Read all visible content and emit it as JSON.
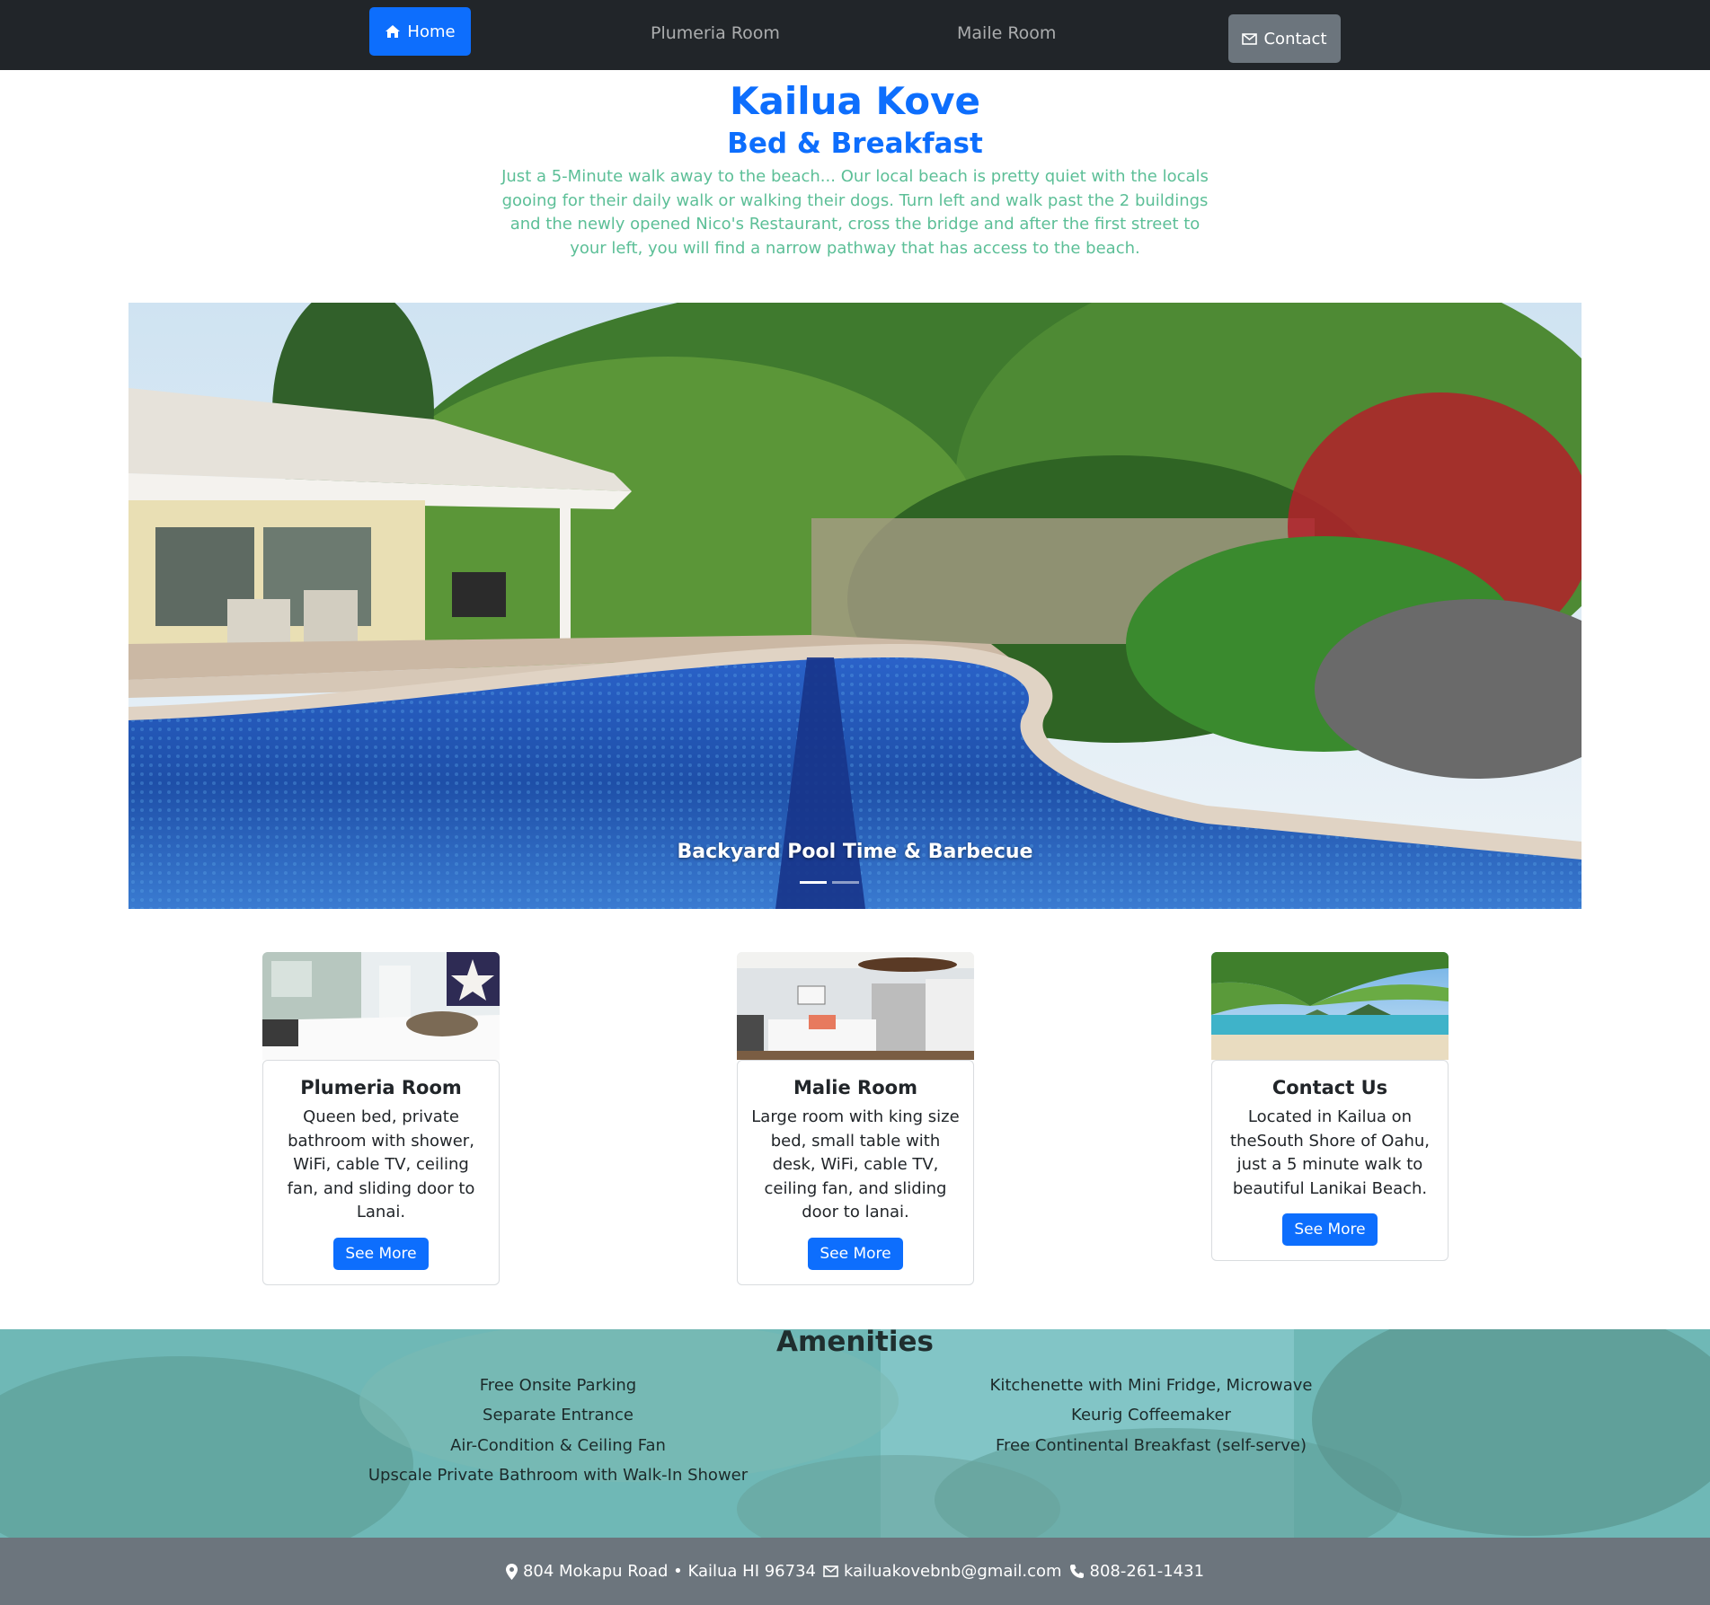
{
  "nav": {
    "home_label": "Home",
    "plumeria_label": "Plumeria Room",
    "maile_label": "Maile Room",
    "contact_label": "Contact"
  },
  "header": {
    "title": "Kailua Kove",
    "subtitle": "Bed & Breakfast",
    "intro": "Just a 5-Minute walk away to the beach... Our local beach is pretty quiet with the locals gooing for their daily walk or walking their dogs. Turn left and walk past the 2 buildings and the newly opened Nico's Restaurant, cross the bridge and after the first street to your left, you will find a narrow pathway that has access to the beach."
  },
  "carousel": {
    "caption": "Backyard Pool Time & Barbecue"
  },
  "cards": [
    {
      "title": "Plumeria Room",
      "text": "Queen bed, private bathroom with shower, WiFi, cable TV, ceiling fan, and sliding door to Lanai.",
      "button": "See More"
    },
    {
      "title": "Malie Room",
      "text": "Large room with king size bed, small table with desk, WiFi, cable TV, ceiling fan, and sliding door to lanai.",
      "button": "See More"
    },
    {
      "title": "Contact Us",
      "text": "Located in Kailua on theSouth Shore of Oahu, just a 5 minute walk to beautiful Lanikai Beach.",
      "button": "See More"
    }
  ],
  "amenities": {
    "title": "Amenities",
    "left": [
      "Free Onsite Parking",
      "Separate Entrance",
      "Air-Condition & Ceiling Fan",
      "Upscale Private Bathroom with Walk-In Shower"
    ],
    "right": [
      "Kitchenette with Mini Fridge, Microwave",
      "Keurig Coffeemaker",
      "Free Continental Breakfast (self-serve)"
    ]
  },
  "footer": {
    "address": "804 Mokapu Road • Kailua HI 96734",
    "email": "kailuakovebnb@gmail.com",
    "phone": "808-261-1431"
  },
  "colors": {
    "primary": "#0d6efd",
    "navbar": "#212529",
    "secondary": "#6c757d",
    "intro_text": "#5cbf97",
    "amenities_bg": "#74bcba"
  }
}
